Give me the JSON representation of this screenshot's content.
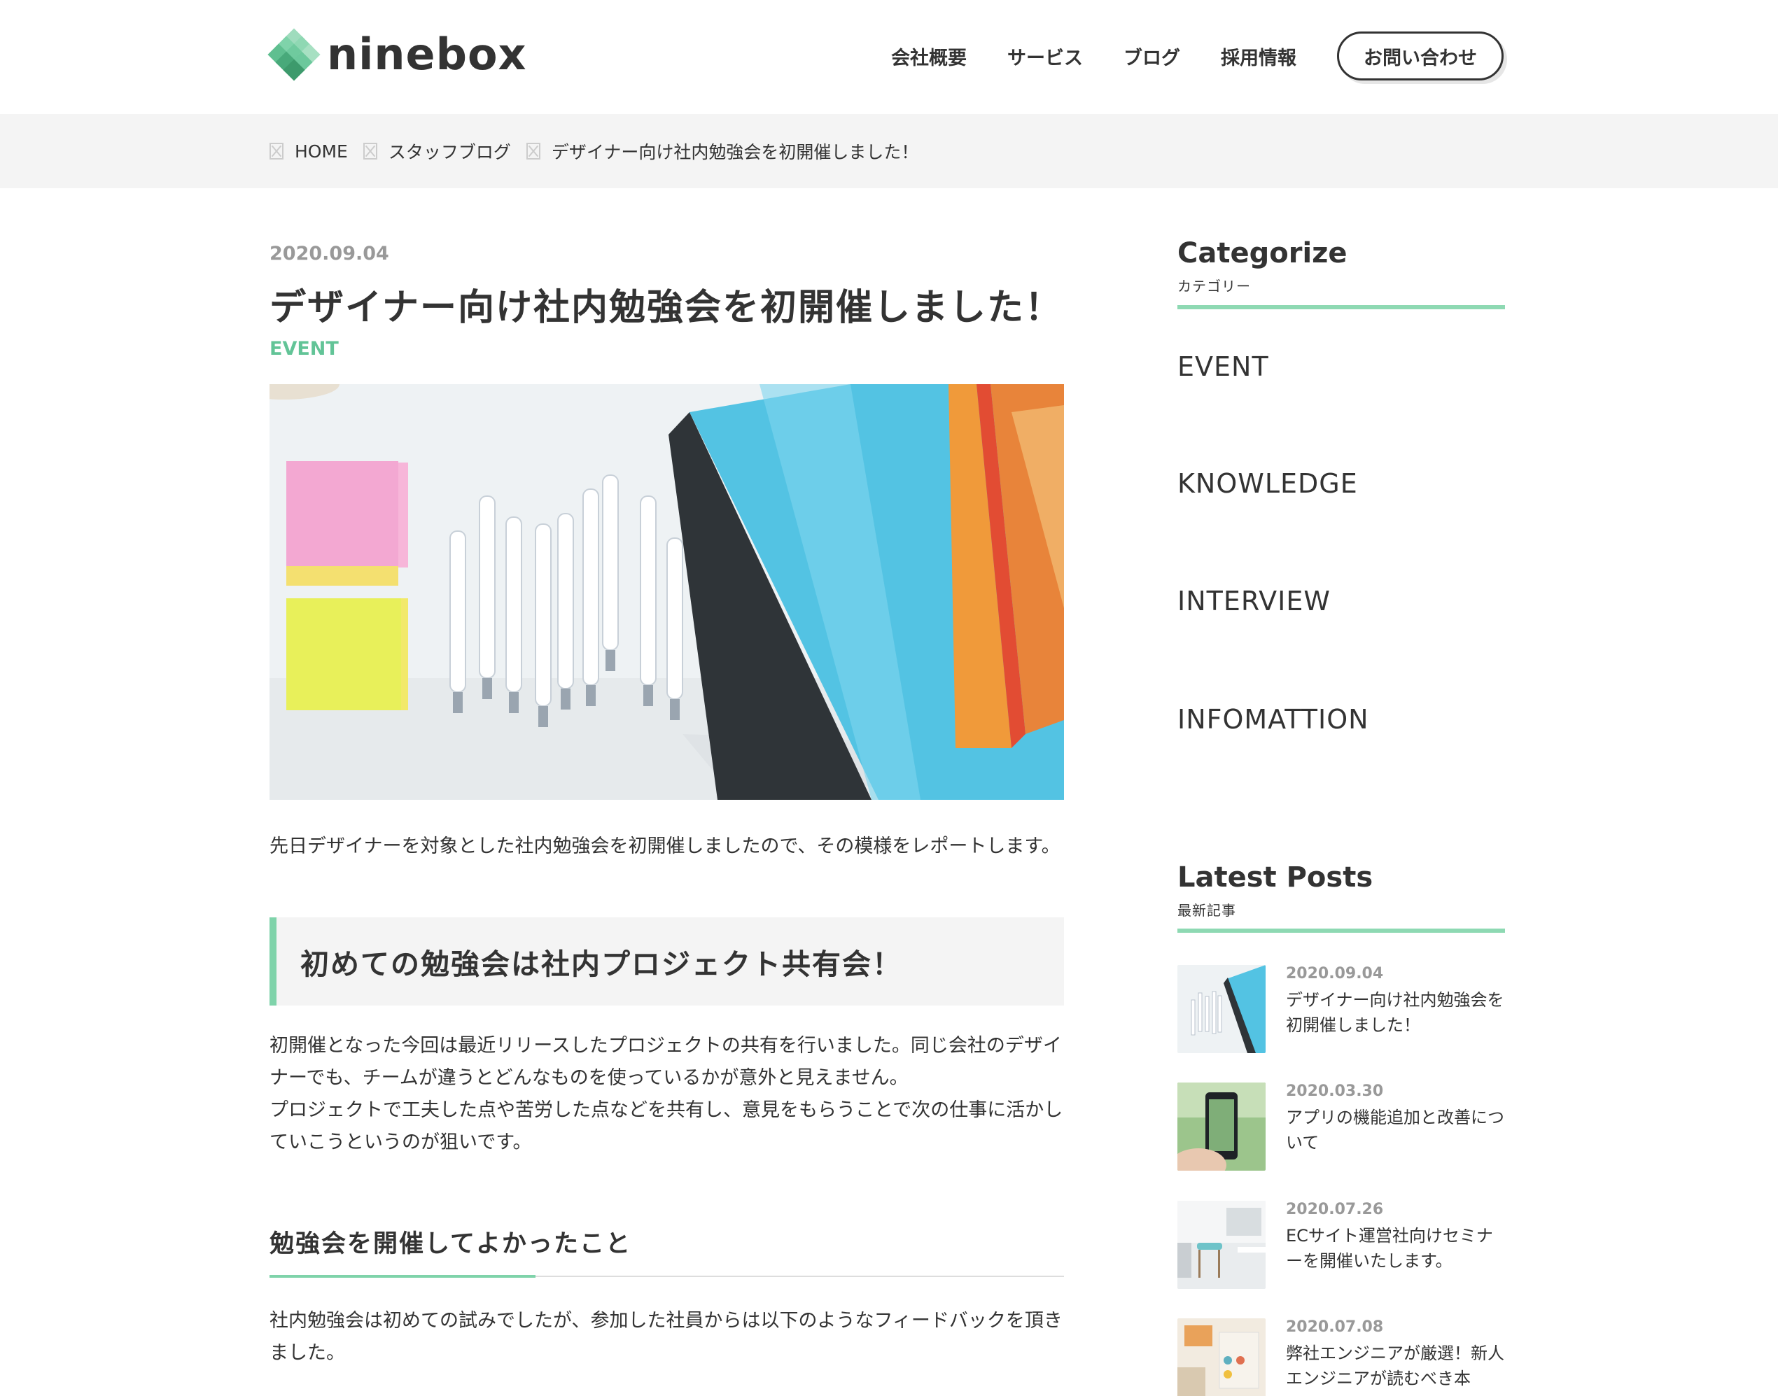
{
  "header": {
    "logo_text": "ninebox",
    "nav": [
      "会社概要",
      "サービス",
      "ブログ",
      "採用情報"
    ],
    "contact_label": "お問い合わせ"
  },
  "breadcrumb": [
    "HOME",
    "スタッフブログ",
    "デザイナー向け社内勉強会を初開催しました！"
  ],
  "article": {
    "date": "2020.09.04",
    "title": "デザイナー向け社内勉強会を初開催しました！",
    "category": "EVENT",
    "intro": "先日デザイナーを対象とした社内勉強会を初開催しましたので、その模様をレポートします。",
    "heading1": "初めての勉強会は社内プロジェクト共有会！",
    "para1_line1": "初開催となった今回は最近リリースしたプロジェクトの共有を行いました。同じ会社のデザイナーでも、チームが違うとどんなものを使っているかが意外と見えません。",
    "para1_line2": "プロジェクトで工夫した点や苦労した点などを共有し、意見をもらうことで次の仕事に活かしていこうというのが狙いです。",
    "heading2": "勉強会を開催してよかったこと",
    "para2": "社内勉強会は初めての試みでしたが、参加した社員からは以下のようなフィードバックを頂きました。"
  },
  "sidebar": {
    "categorize_title": "Categorize",
    "categorize_sub": "カテゴリー",
    "categories": [
      "EVENT",
      "KNOWLEDGE",
      "INTERVIEW",
      "INFOMATTION"
    ],
    "latest_title": "Latest Posts",
    "latest_sub": "最新記事",
    "latest_posts": [
      {
        "date": "2020.09.04",
        "title": "デザイナー向け社内勉強会を初開催しました！"
      },
      {
        "date": "2020.03.30",
        "title": "アプリの機能追加と改善について"
      },
      {
        "date": "2020.07.26",
        "title": "ECサイト運営社向けセミナーを開催いたします。"
      },
      {
        "date": "2020.07.08",
        "title": "弊社エンジニアが厳選！新人エンジニアが読むべき本"
      }
    ]
  },
  "colors": {
    "accent": "#62c497",
    "accent_light": "#8ed9b3",
    "text": "#333333",
    "muted": "#999999",
    "band": "#f4f4f4"
  }
}
